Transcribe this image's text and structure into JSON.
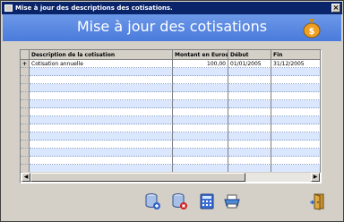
{
  "window": {
    "title": "Mise à jour des descriptions des cotisations."
  },
  "banner": {
    "heading": "Mise à jour des cotisations"
  },
  "grid": {
    "columns": [
      "Description de la cotisation",
      "Montant en Euros",
      "Début",
      "Fin"
    ],
    "rows": [
      {
        "marker": "+",
        "description": "Cotisation annuelle",
        "montant": "100,00",
        "debut": "01/01/2005",
        "fin": "31/12/2005"
      }
    ],
    "empty_row_count": 13
  },
  "icons": {
    "app": "window-icon",
    "money": "money-bag-icon",
    "add": "add-database-icon",
    "delete": "delete-database-icon",
    "calculator": "calculator-icon",
    "print": "printer-icon",
    "exit": "exit-door-icon"
  },
  "colors": {
    "titlebar": "#0a246a",
    "banner": "#5b8be2",
    "row_alt": "#dbe7ff"
  }
}
